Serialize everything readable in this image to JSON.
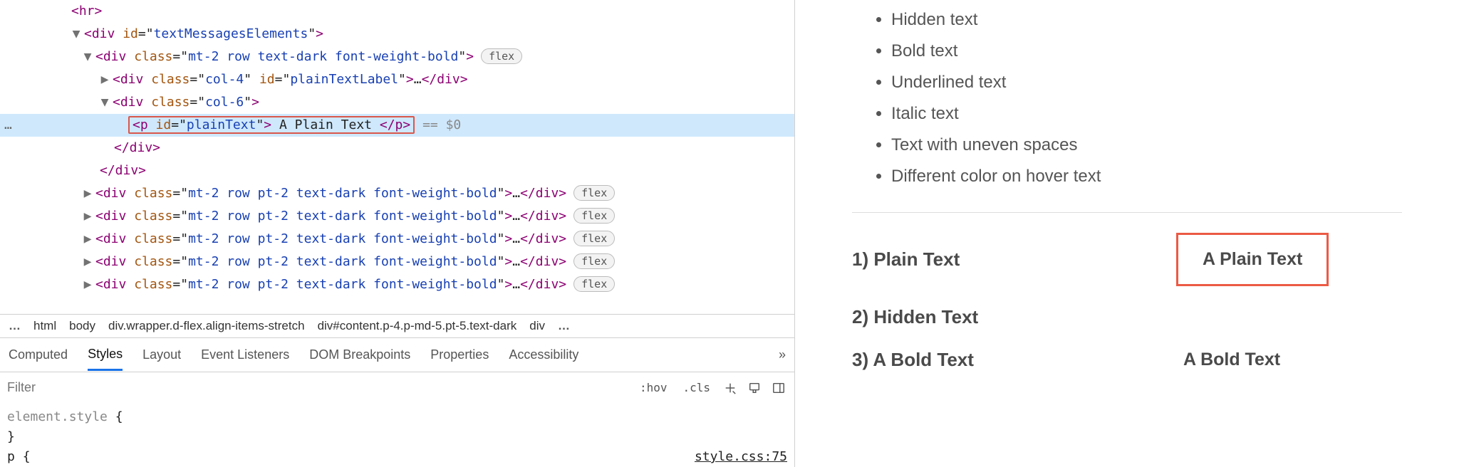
{
  "dom": {
    "hr": {
      "open": "<hr>"
    },
    "n1": {
      "tri": "▼",
      "tag": "div",
      "attr": "id",
      "val": "textMessagesElements",
      "end": ">"
    },
    "n2": {
      "tri": "▼",
      "tag": "div",
      "attr": "class",
      "val": "mt-2 row text-dark font-weight-bold",
      "pill": "flex"
    },
    "n3": {
      "tri": "▶",
      "tag": "div",
      "attr1": "class",
      "val1": "col-4",
      "attr2": "id",
      "val2": "plainTextLabel",
      "ell": "…",
      "close": "</div>"
    },
    "n4": {
      "tri": "▼",
      "tag": "div",
      "attr": "class",
      "val": "col-6"
    },
    "sel": {
      "gutter": "…",
      "open_tag": "p",
      "open_attr": "id",
      "open_val": "plainText",
      "text": " A Plain Text ",
      "close": "</p>",
      "suffix": "== $0"
    },
    "c1": "</div>",
    "c2": "</div>",
    "rep": {
      "tri": "▶",
      "tag": "div",
      "attr": "class",
      "val": "mt-2 row pt-2 text-dark font-weight-bold",
      "ell": "…",
      "close": "</div>",
      "pill": "flex"
    }
  },
  "crumbs": {
    "more_left": "…",
    "items": [
      "html",
      "body",
      "div.wrapper.d-flex.align-items-stretch",
      "div#content.p-4.p-md-5.pt-5.text-dark",
      "div"
    ],
    "more_right": "…"
  },
  "tabs": {
    "items": [
      "Computed",
      "Styles",
      "Layout",
      "Event Listeners",
      "DOM Breakpoints",
      "Properties",
      "Accessibility"
    ],
    "more": "»"
  },
  "filter": {
    "placeholder": "Filter",
    "hov": ":hov",
    "cls": ".cls"
  },
  "rules": {
    "l1a": "element.style",
    "l1b": " {",
    "l2": "}",
    "l3a": "p ",
    "l3b": "{",
    "src": "style.css:75"
  },
  "preview": {
    "bullets": [
      "Hidden text",
      "Bold text",
      "Underlined text",
      "Italic text",
      "Text with uneven spaces",
      "Different color on hover text"
    ],
    "rows": [
      {
        "label": "1) Plain Text",
        "value": "A Plain Text",
        "hl": true
      },
      {
        "label": "2) Hidden Text",
        "value": ""
      },
      {
        "label": "3) A Bold Text",
        "value": "A Bold Text"
      }
    ]
  }
}
